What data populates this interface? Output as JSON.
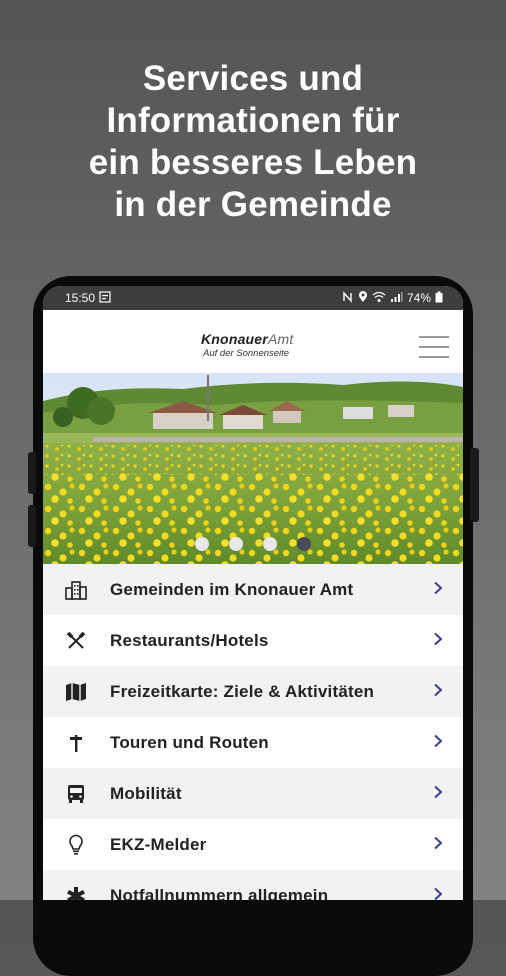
{
  "headline": {
    "lines": [
      "Services und",
      "Informationen für",
      "ein besseres Leben",
      "in der Gemeinde"
    ]
  },
  "statusbar": {
    "time": "15:50",
    "battery": "74%"
  },
  "header": {
    "logo_main": "Knonauer",
    "logo_amt": "Amt",
    "logo_sub": "Auf der Sonnenseite"
  },
  "carousel": {
    "slide_count": 4,
    "active_index": 3
  },
  "menu": {
    "items": [
      {
        "label": "Gemeinden im Knonauer Amt",
        "icon": "buildings-icon"
      },
      {
        "label": "Restaurants/Hotels",
        "icon": "cutlery-icon"
      },
      {
        "label": "Freizeitkarte: Ziele & Aktivitäten",
        "icon": "map-icon"
      },
      {
        "label": "Touren und Routen",
        "icon": "signpost-icon"
      },
      {
        "label": "Mobilität",
        "icon": "bus-icon"
      },
      {
        "label": "EKZ-Melder",
        "icon": "lightbulb-icon"
      },
      {
        "label": "Notfallnummern allgemein",
        "icon": "medical-icon"
      }
    ]
  },
  "colors": {
    "accent": "#3a3f8f",
    "alt_row": "#f2f2f2",
    "statusbar": "#3d3d3d"
  }
}
